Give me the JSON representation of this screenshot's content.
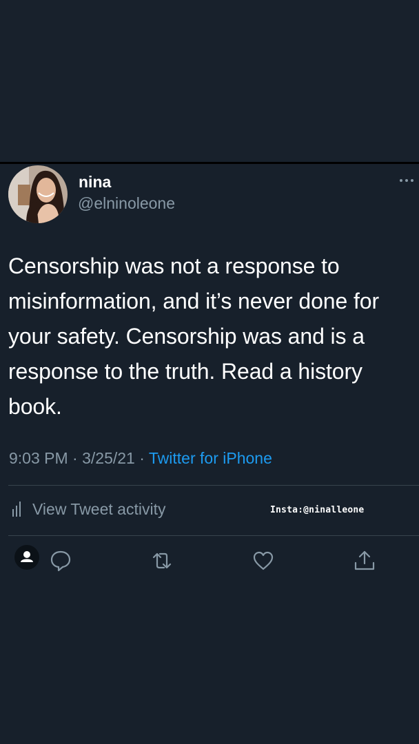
{
  "user": {
    "name": "nina",
    "handle": "@elninoleone"
  },
  "tweet": {
    "text": "Censorship was not a response to misinformation, and it’s never done for your safety. Censorship was and is a response to the truth. Read a history book.",
    "time": "9:03 PM",
    "date": "3/25/21",
    "separator": "·",
    "source": "Twitter for iPhone"
  },
  "activity": {
    "label": "View Tweet activity"
  },
  "watermark": "Insta:@ninalleone",
  "colors": {
    "background": "#17202b",
    "text_primary": "#ffffff",
    "text_secondary": "#8899a6",
    "link": "#1d9bf0",
    "divider": "#38444d"
  },
  "icons": [
    "more-icon",
    "activity-bars-icon",
    "user-icon",
    "reply-icon",
    "retweet-icon",
    "like-icon",
    "share-icon"
  ]
}
